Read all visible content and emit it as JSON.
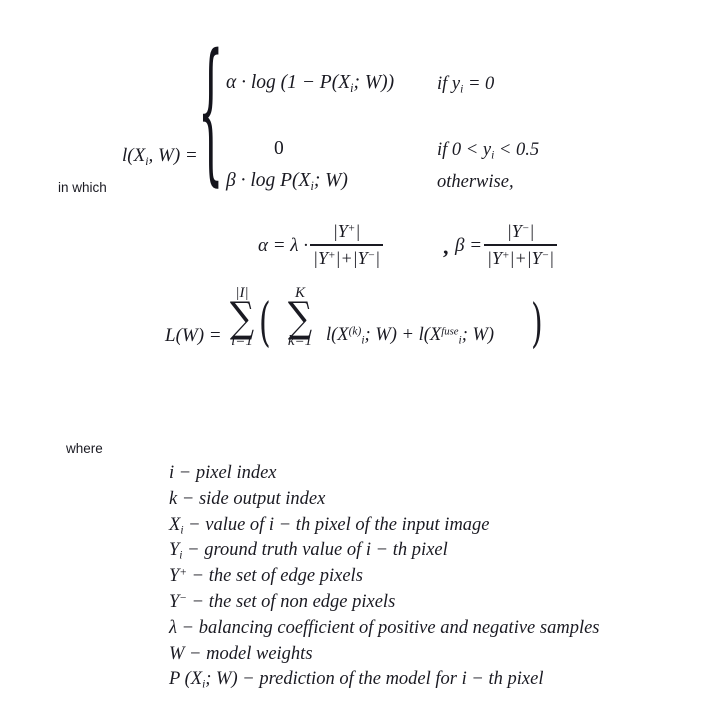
{
  "document": {
    "type": "mathematical-formula-figure",
    "background_color": "#ffffff",
    "text_color": "#1a1a22"
  },
  "piecewise": {
    "lhs": "l(X",
    "lhs_sub": "i",
    "lhs_rest": ", W)  =",
    "cases": [
      {
        "expr_prefix": "α · log (1  −  P(X",
        "expr_sub": "i",
        "expr_suffix": "; W))",
        "condition_prefix": "if y",
        "condition_sub": "i",
        "condition_suffix": " = 0"
      },
      {
        "expr_prefix": "0",
        "expr_sub": "",
        "expr_suffix": "",
        "condition_prefix": "if 0 < y",
        "condition_sub": "i",
        "condition_suffix": " < 0.5"
      },
      {
        "expr_prefix": "β · log P(X",
        "expr_sub": "i",
        "expr_suffix": "; W)",
        "condition_prefix": "otherwise,",
        "condition_sub": "",
        "condition_suffix": ""
      }
    ],
    "brace": "{"
  },
  "in_which_label": "in which",
  "alpha_beta": {
    "alpha_lead": "α = λ ·",
    "alpha_numerator": "|Y",
    "alpha_numerator_sup": "+",
    "alpha_numerator_tail": "|",
    "alpha_denominator": "|Y",
    "alpha_denominator_sup1": "+",
    "alpha_denominator_mid": "|+|Y",
    "alpha_denominator_sup2": "−",
    "alpha_denominator_tail": "|",
    "separator": ",",
    "beta_lead": "β =",
    "beta_numerator": "|Y",
    "beta_numerator_sup": "−",
    "beta_numerator_tail": "|",
    "beta_denominator": "|Y",
    "beta_denominator_sup1": "+",
    "beta_denominator_mid": "|+|Y",
    "beta_denominator_sup2": "−",
    "beta_denominator_tail": "|"
  },
  "loss": {
    "lhs": "L(W)  =",
    "outer_sum": {
      "upper": "|I|",
      "sigma": "∑",
      "lower": "i=1"
    },
    "inner_sum": {
      "upper": "K",
      "sigma": "∑",
      "lower": "k=1"
    },
    "paren_open": "(",
    "paren_close": ")",
    "body_1": "l(X",
    "body_1_sup": "(k)",
    "body_1_sub": "i",
    "body_1_tail": "; W)",
    "body_plus": " + ",
    "body_2": "l(X",
    "body_2_sup": "fuse",
    "body_2_sub": "i",
    "body_2_tail": "; W)"
  },
  "where_label": "where",
  "legend": [
    {
      "symbol": "i",
      "symbol_sup": "",
      "symbol_sub": "",
      "dash": "−",
      "description": "pixel index"
    },
    {
      "symbol": "k",
      "symbol_sup": "",
      "symbol_sub": "",
      "dash": "−",
      "description": "side output index"
    },
    {
      "symbol": "X",
      "symbol_sup": "",
      "symbol_sub": "i",
      "dash": "−",
      "description": "value of i − th pixel of the input image"
    },
    {
      "symbol": "Y",
      "symbol_sup": "",
      "symbol_sub": "i",
      "dash": "−",
      "description": "ground truth value of i − th pixel"
    },
    {
      "symbol": "Y",
      "symbol_sup": "+",
      "symbol_sub": "",
      "dash": "−",
      "description": "the set of edge pixels"
    },
    {
      "symbol": "Y",
      "symbol_sup": "−",
      "symbol_sub": "",
      "dash": "−",
      "description": "the set of non edge pixels"
    },
    {
      "symbol": "λ",
      "symbol_sup": "",
      "symbol_sub": "",
      "dash": "−",
      "description": "balancing coefficient of positive and negative samples"
    },
    {
      "symbol": "W",
      "symbol_sup": "",
      "symbol_sub": "",
      "dash": "−",
      "description": "model weights"
    },
    {
      "symbol": "P (X",
      "symbol_sup": "",
      "symbol_sub": "i",
      "symbol_tail": "; W)",
      "dash": "−",
      "description": "prediction of the model for i − th pixel"
    }
  ]
}
